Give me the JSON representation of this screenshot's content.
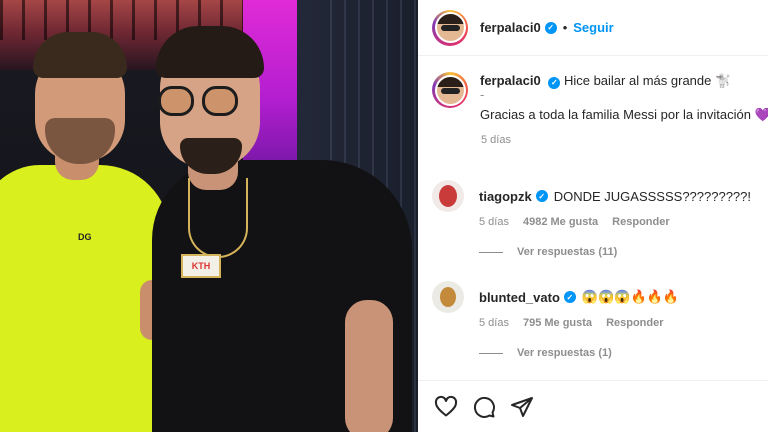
{
  "header": {
    "username": "ferpalaci0",
    "verified_glyph": "✓",
    "separator": "•",
    "follow_label": "Seguir"
  },
  "caption": {
    "username": "ferpalaci0",
    "text": "Hice bailar al más grande 🐩",
    "separator": "-",
    "line2": "Gracias a toda la familia Messi por la invitación 💜",
    "time": "5 días"
  },
  "comments": [
    {
      "username": "tiagopzk",
      "text": "DONDE JUGASSSSS?????????!",
      "time": "5 días",
      "likes": "4982 Me gusta",
      "reply_label": "Responder",
      "replies_label": "Ver respuestas (11)"
    },
    {
      "username": "blunted_vato",
      "text": "😱😱😱🔥🔥🔥",
      "time": "5 días",
      "likes": "795 Me gusta",
      "reply_label": "Responder",
      "replies_label": "Ver respuestas (1)"
    }
  ],
  "photo": {
    "shirt_logo": "DG",
    "pendant_text": "KTH"
  },
  "actions": [
    "heart-icon",
    "comment-icon",
    "share-icon"
  ],
  "colors": {
    "accent": "#0095f6",
    "text": "#262626",
    "muted": "#8e8e8e"
  }
}
